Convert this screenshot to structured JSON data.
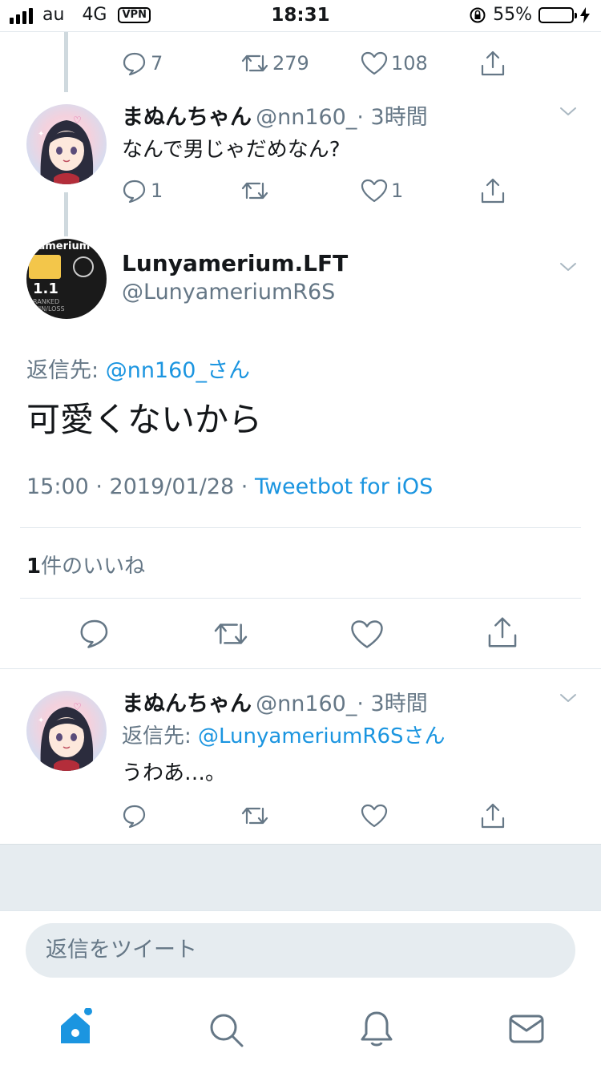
{
  "status_bar": {
    "carrier": "au",
    "network": "4G",
    "vpn": "VPN",
    "time": "18:31",
    "battery": "55%",
    "battery_level": 0.55
  },
  "tweet_prev": {
    "stats": {
      "replies": "7",
      "retweets": "279",
      "likes": "108"
    }
  },
  "reply1": {
    "name": "まぬんちゃん",
    "handle": "@nn160_",
    "time": "· 3時間",
    "text": "なんで男じゃだめなん?",
    "stats": {
      "replies": "1",
      "likes": "1"
    }
  },
  "main_tweet": {
    "name": "Lunyamerium.LFT",
    "handle": "@LunyameriumR6S",
    "reply_to_label": "返信先:",
    "reply_to": "@nn160_さん",
    "text": "可愛くないから",
    "timestamp": "15:00 · 2019/01/28 · ",
    "source": "Tweetbot for iOS",
    "likes_count": "1",
    "likes_label": "件のいいね",
    "avatar_text": {
      "top": "yamerium",
      "big": "1.1",
      "small1": "RANKED",
      "small2": "WIN/LOSS"
    }
  },
  "reply2": {
    "name": "まぬんちゃん",
    "handle": "@nn160_",
    "time": "· 3時間",
    "reply_to_label": "返信先:",
    "reply_to": "@LunyameriumR6Sさん",
    "text": "うわあ…。"
  },
  "reply_input": {
    "placeholder": "返信をツイート"
  },
  "tab_bar": {
    "items": [
      "home-icon",
      "search-icon",
      "notifications-icon",
      "messages-icon"
    ],
    "active": "home-icon"
  },
  "colors": {
    "accent": "#1b95e0",
    "muted": "#657786",
    "separator": "#e6ecf0"
  }
}
